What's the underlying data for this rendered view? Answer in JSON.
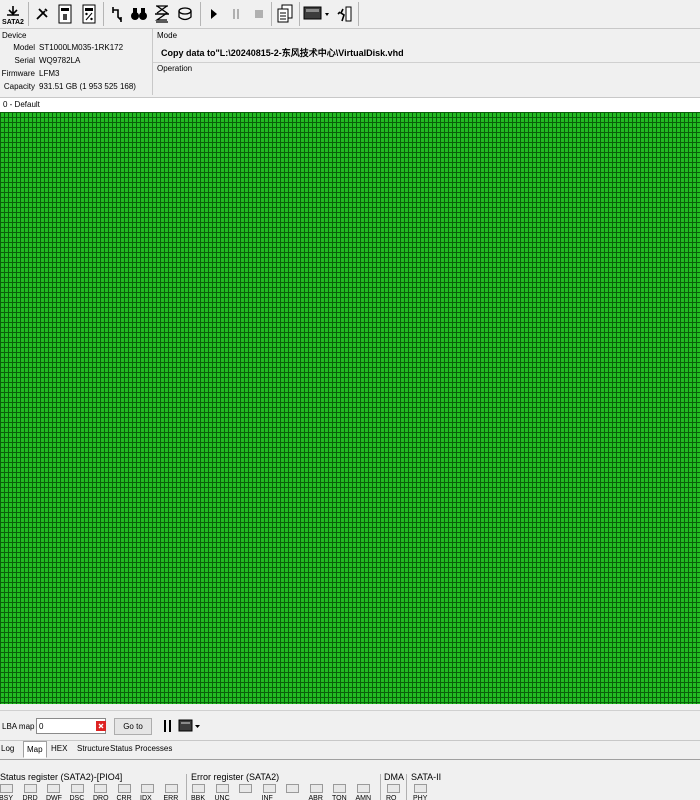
{
  "toolbar": {
    "sata_label": "SATA2",
    "buttons": [
      {
        "name": "sata-port-button",
        "icon": "port-icon"
      },
      {
        "name": "tools-button",
        "icon": "wrench-screwdriver-icon"
      },
      {
        "name": "smart-button",
        "icon": "smart-sheet-icon"
      },
      {
        "name": "percent-button",
        "icon": "percent-sheet-icon"
      },
      {
        "name": "connect-button",
        "icon": "plug-icon"
      },
      {
        "name": "search-button",
        "icon": "binoculars-icon"
      },
      {
        "name": "erase-button",
        "icon": "hourglass-icon"
      },
      {
        "name": "disk-button",
        "icon": "disk-icon"
      },
      {
        "name": "play-button",
        "icon": "play-icon"
      },
      {
        "name": "pause-button",
        "icon": "pause-icon"
      },
      {
        "name": "stop-button",
        "icon": "stop-icon"
      },
      {
        "name": "copy-button",
        "icon": "copy-document-icon"
      },
      {
        "name": "monitor-button",
        "icon": "monitor-icon"
      },
      {
        "name": "exit-button",
        "icon": "exit-door-icon"
      }
    ]
  },
  "device": {
    "title": "Device",
    "model_label": "Model",
    "model": "ST1000LM035-1RK172",
    "serial_label": "Serial",
    "serial": "WQ9782LA",
    "firmware_label": "Firmware",
    "firmware": "LFM3",
    "capacity_label": "Capacity",
    "capacity": "931.51 GB (1 953 525 168)"
  },
  "mode": {
    "title": "Mode",
    "value": "Copy data to\"L:\\20240815-2-东风技术中心\\VirtualDisk.vhd",
    "operation_label": "Operation"
  },
  "map": {
    "header": "0 - Default",
    "block_color": "#22bb22",
    "block_border": "#0b5f0b",
    "status": "all blocks read (green)"
  },
  "lba": {
    "label": "LBA map",
    "value": "0",
    "goto_label": "Go to"
  },
  "tabs": [
    "Log",
    "Map",
    "HEX",
    "Structure",
    "Status",
    "Processes"
  ],
  "active_tab": "Map",
  "registers": {
    "status_title": "Status register (SATA2)-[PIO4]",
    "status_leds": [
      "BSY",
      "DRD",
      "DWF",
      "DSC",
      "DRQ",
      "CRR",
      "IDX",
      "ERR"
    ],
    "error_title": "Error register (SATA2)",
    "error_leds": [
      "BBK",
      "UNC",
      "",
      "INF",
      "",
      "ABR",
      "TON",
      "AMN"
    ],
    "dma_title": "DMA",
    "dma_leds": [
      "RQ"
    ],
    "sata_title": "SATA-II",
    "sata_leds": [
      "PHY"
    ]
  }
}
